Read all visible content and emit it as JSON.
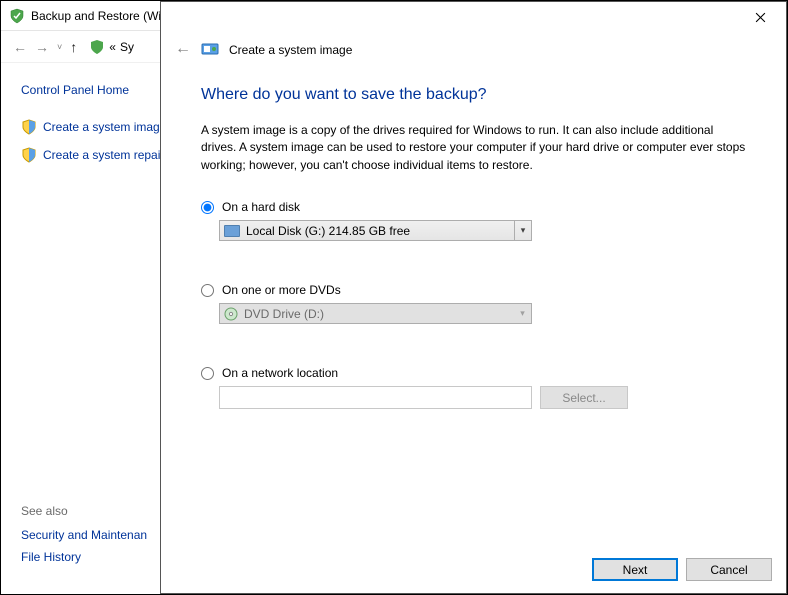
{
  "bg": {
    "title": "Backup and Restore (Wi",
    "breadcrumb_prefix": "«",
    "breadcrumb_seg": "Sy",
    "cp_home": "Control Panel Home",
    "task_create_image": "Create a system image",
    "task_create_repair": "Create a system repair d",
    "see_also": "See also",
    "link_security": "Security and Maintenan",
    "link_filehistory": "File History"
  },
  "dlg": {
    "header_text": "Create a system image",
    "heading": "Where do you want to save the backup?",
    "description": "A system image is a copy of the drives required for Windows to run. It can also include additional drives. A system image can be used to restore your computer if your hard drive or computer ever stops working; however, you can't choose individual items to restore.",
    "opt_hd": "On a hard disk",
    "hd_value": "Local Disk (G:)  214.85 GB free",
    "opt_dvd": "On one or more DVDs",
    "dvd_value": "DVD Drive (D:)",
    "opt_net": "On a network location",
    "select_btn": "Select...",
    "next": "Next",
    "cancel": "Cancel"
  }
}
